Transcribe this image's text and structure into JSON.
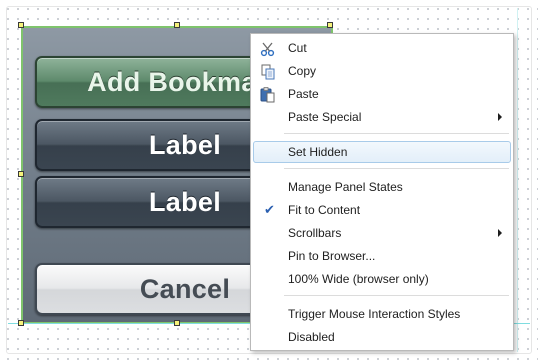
{
  "panel_buttons": {
    "add_bookmark": "Add Bookmark",
    "label_1": "Label",
    "label_2": "Label",
    "cancel": "Cancel"
  },
  "context_menu": {
    "items": [
      {
        "label": "Cut",
        "icon": "scissors-icon"
      },
      {
        "label": "Copy",
        "icon": "copy-icon"
      },
      {
        "label": "Paste",
        "icon": "paste-icon"
      },
      {
        "label": "Paste Special",
        "submenu": true
      },
      {
        "label": "Set Hidden",
        "highlighted": true
      },
      {
        "label": "Manage Panel States"
      },
      {
        "label": "Fit to Content",
        "checked": true,
        "icon": "checkmark-icon"
      },
      {
        "label": "Scrollbars",
        "submenu": true
      },
      {
        "label": "Pin to Browser..."
      },
      {
        "label": "100% Wide (browser only)"
      },
      {
        "label": "Trigger Mouse Interaction Styles"
      },
      {
        "label": "Disabled"
      }
    ]
  },
  "colors": {
    "selection_border": "#7fc46c",
    "menu_highlight": "#e3eff9",
    "guide_line": "#7fdde0"
  }
}
